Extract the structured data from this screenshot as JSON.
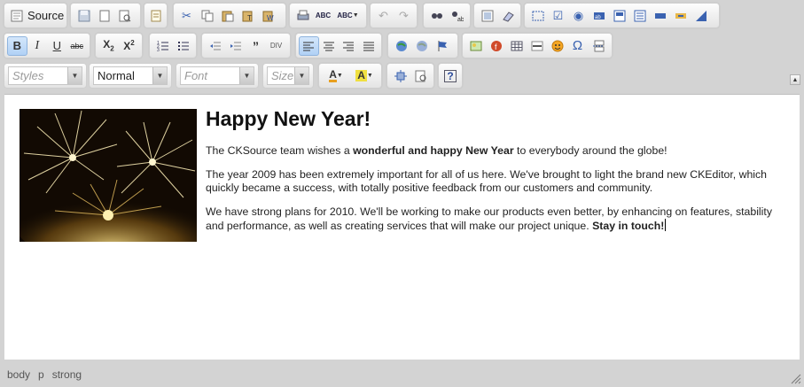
{
  "toolbar": {
    "source_label": "Source",
    "row1_icons": [
      "save-icon",
      "new-page-icon",
      "preview-icon",
      "templates-icon",
      "cut-icon",
      "copy-icon",
      "paste-icon",
      "paste-text-icon",
      "paste-word-icon",
      "print-icon",
      "spellcheck-icon",
      "scayt-icon",
      "undo-icon",
      "redo-icon",
      "find-icon",
      "replace-icon",
      "select-all-icon",
      "remove-format-icon",
      "form-icon",
      "checkbox-icon",
      "radio-icon",
      "textfield-icon",
      "textarea-icon",
      "select-field-icon",
      "button-icon",
      "image-button-icon",
      "hidden-field-icon"
    ],
    "row2_icons": [
      "bold-icon",
      "italic-icon",
      "underline-icon",
      "strike-icon",
      "subscript-icon",
      "superscript-icon",
      "numbered-list-icon",
      "bulleted-list-icon",
      "outdent-icon",
      "indent-icon",
      "blockquote-icon",
      "div-icon",
      "align-left-icon",
      "align-center-icon",
      "align-right-icon",
      "justify-icon",
      "link-icon",
      "unlink-icon",
      "anchor-icon",
      "image-icon",
      "flash-icon",
      "table-icon",
      "horizontal-rule-icon",
      "smiley-icon",
      "special-char-icon",
      "page-break-icon"
    ],
    "styles": {
      "placeholder": "Styles"
    },
    "format": {
      "value": "Normal"
    },
    "font": {
      "placeholder": "Font"
    },
    "size": {
      "placeholder": "Size"
    }
  },
  "colors": {
    "accent": "#8fb4de",
    "bg": "#d3d3d3",
    "text": "#222222"
  },
  "content": {
    "heading": "Happy New Year!",
    "p1_a": "The CKSource team wishes a ",
    "p1_b": "wonderful and happy New Year",
    "p1_c": " to everybody around the globe!",
    "p2": "The year 2009 has been extremely important for all of us here. We've brought to light the brand new CKEditor, which quickly became a success, with totally positive feedback from our customers and community.",
    "p3_a": "We have strong plans for 2010. We'll be working to make our products even better, by enhancing on features, stability and performance, as well as creating services that will make our project unique. ",
    "p3_b": "Stay in touch!"
  },
  "status": {
    "path": [
      "body",
      "p",
      "strong"
    ]
  }
}
